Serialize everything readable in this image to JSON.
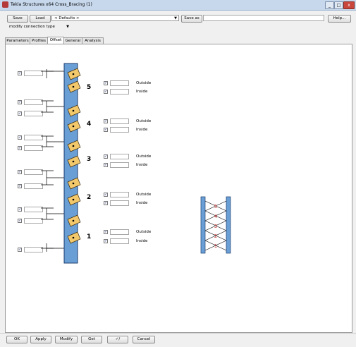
{
  "window": {
    "title": "Tekla Structures x64  Cross_Bracing (1)",
    "minimize": "_",
    "maximize": "□",
    "close": "x"
  },
  "toolbar": {
    "save_label": "Save",
    "load_label": "Load",
    "attribute_file": "< Defaults >",
    "save_as_label": "Save as",
    "save_as_value": "",
    "help_label": "Help..."
  },
  "mode_combo": "modify connection type",
  "tabs": [
    "Parameters",
    "Profiles",
    "Offset",
    "General",
    "Analysis"
  ],
  "active_tab": "Offset",
  "offset": {
    "outside_label": "Outside",
    "inside_label": "Inside",
    "levels": [
      "5",
      "4",
      "3",
      "2",
      "1"
    ]
  },
  "bottom": {
    "ok_label": "OK",
    "apply_label": "Apply",
    "modify_label": "Modify",
    "get_label": "Get",
    "toggle_label": "✓/",
    "cancel_label": "Cancel"
  },
  "colors": {
    "column": "#6a9fd6",
    "plate": "#f2c86b",
    "check": "#2b3f9e",
    "diagram_numbers": "#d03030"
  }
}
